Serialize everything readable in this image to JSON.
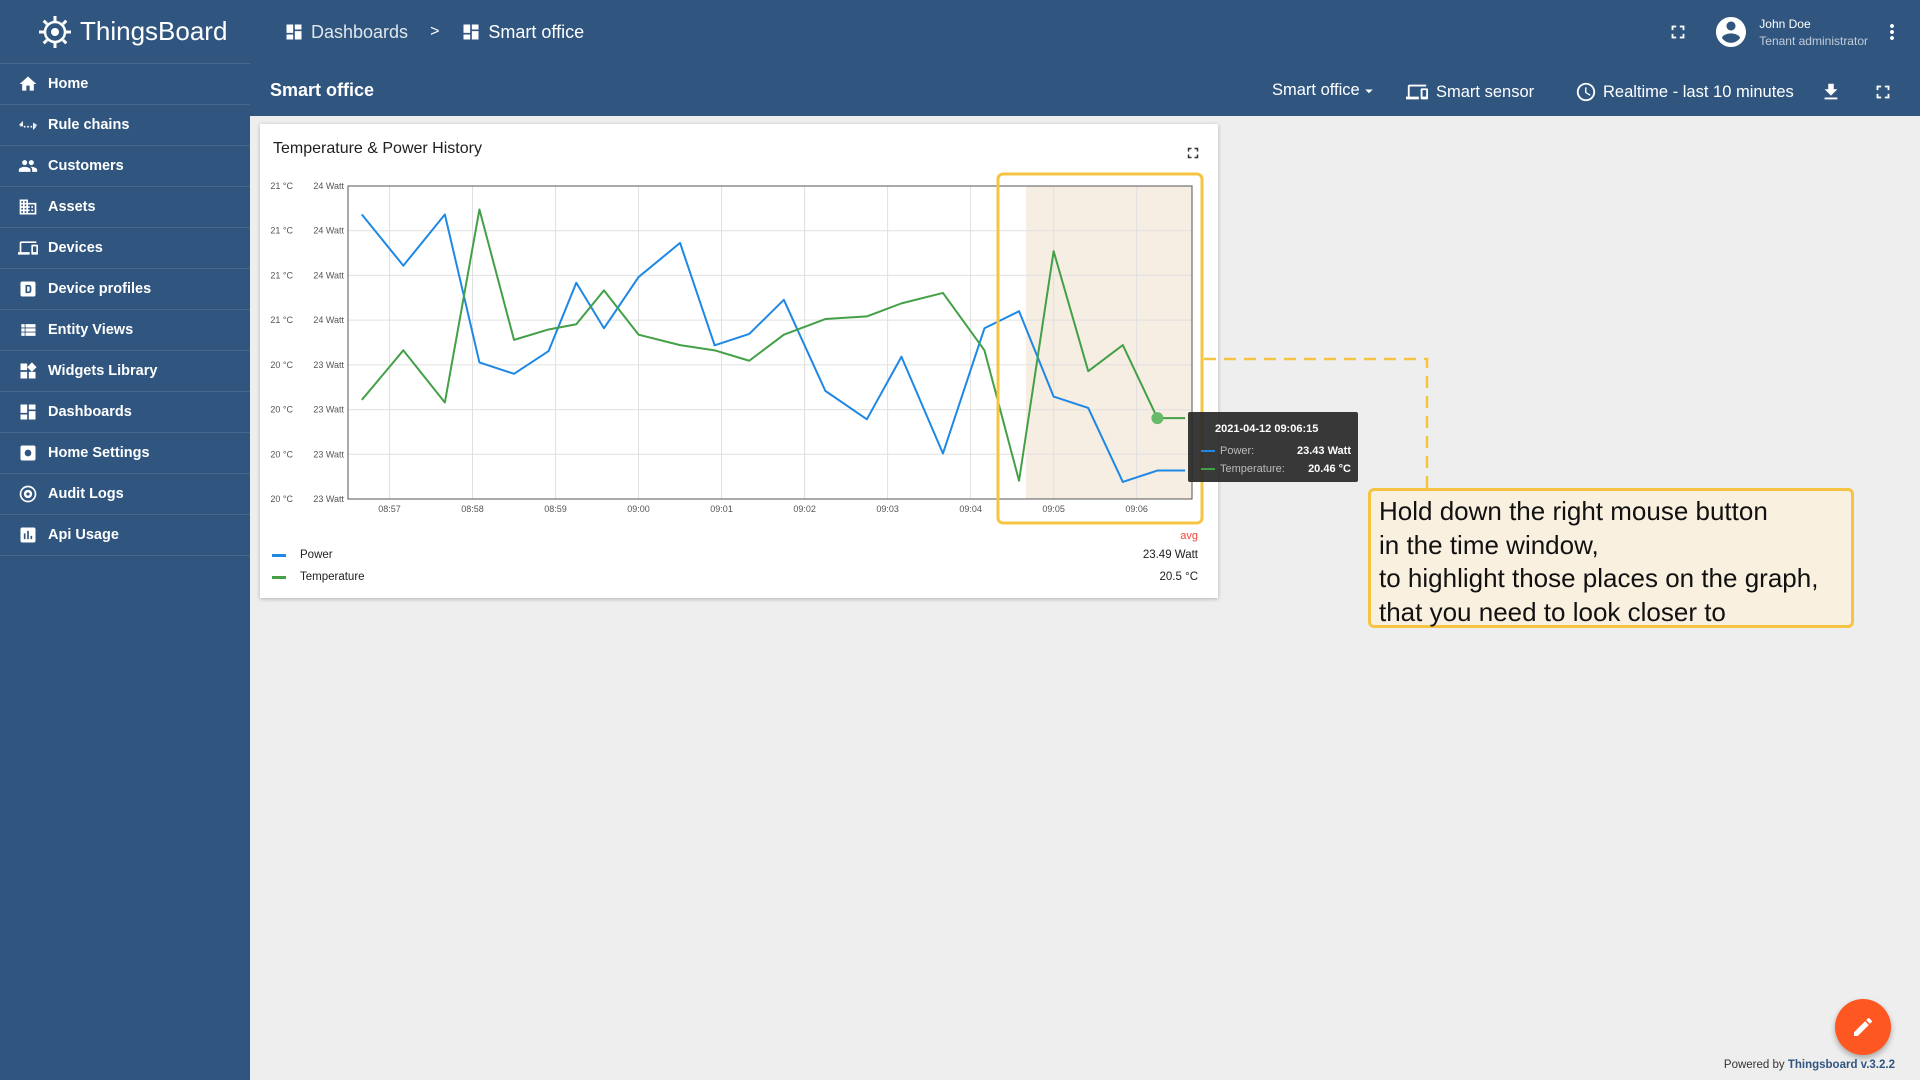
{
  "app": {
    "name": "ThingsBoard"
  },
  "sidebar": {
    "items": [
      {
        "label": "Home",
        "icon": "home-icon"
      },
      {
        "label": "Rule chains",
        "icon": "rule-chains-icon"
      },
      {
        "label": "Customers",
        "icon": "customers-icon"
      },
      {
        "label": "Assets",
        "icon": "assets-icon"
      },
      {
        "label": "Devices",
        "icon": "devices-icon"
      },
      {
        "label": "Device profiles",
        "icon": "device-profiles-icon"
      },
      {
        "label": "Entity Views",
        "icon": "entity-views-icon"
      },
      {
        "label": "Widgets Library",
        "icon": "widgets-icon"
      },
      {
        "label": "Dashboards",
        "icon": "dashboards-icon"
      },
      {
        "label": "Home Settings",
        "icon": "settings-icon"
      },
      {
        "label": "Audit Logs",
        "icon": "audit-logs-icon"
      },
      {
        "label": "Api Usage",
        "icon": "api-usage-icon"
      }
    ]
  },
  "breadcrumb": {
    "root": "Dashboards",
    "separator": ">",
    "current": "Smart office"
  },
  "user": {
    "name": "John Doe",
    "role": "Tenant administrator"
  },
  "toolbar": {
    "dashboard_title": "Smart office",
    "state_select": "Smart office",
    "entity": "Smart sensor",
    "timewindow": "Realtime - last 10 minutes"
  },
  "widget": {
    "title": "Temperature & Power History",
    "avg_header": "avg",
    "legend": [
      {
        "name": "Power",
        "color": "#1e88e5",
        "avg": "23.49 Watt"
      },
      {
        "name": "Temperature",
        "color": "#43a047",
        "avg": "20.5 °C"
      }
    ]
  },
  "chart_data": {
    "type": "line",
    "x": [
      "08:56:40",
      "08:57:10",
      "08:57:40",
      "08:58:05",
      "08:58:30",
      "08:58:55",
      "08:59:15",
      "08:59:35",
      "09:00:00",
      "09:00:30",
      "09:00:55",
      "09:01:20",
      "09:01:45",
      "09:02:15",
      "09:02:45",
      "09:03:10",
      "09:03:40",
      "09:04:10",
      "09:04:35",
      "09:05:00",
      "09:05:25",
      "09:05:50",
      "09:06:15",
      "09:06:35"
    ],
    "series": [
      {
        "name": "Power",
        "values": [
          23.88,
          23.79,
          23.88,
          23.62,
          23.6,
          23.64,
          23.76,
          23.68,
          23.77,
          23.83,
          23.65,
          23.67,
          23.73,
          23.57,
          23.52,
          23.63,
          23.46,
          23.68,
          23.71,
          23.56,
          23.54,
          23.41,
          23.43,
          23.43
        ]
      },
      {
        "name": "Temperature",
        "values": [
          20.53,
          20.72,
          20.52,
          21.26,
          20.76,
          20.8,
          20.82,
          20.95,
          20.78,
          20.74,
          20.72,
          20.68,
          20.78,
          20.84,
          20.85,
          20.9,
          20.94,
          20.72,
          20.22,
          21.1,
          20.64,
          20.74,
          20.46,
          20.46
        ]
      }
    ],
    "x_ticks": [
      "08:57",
      "08:58",
      "08:59",
      "09:00",
      "09:01",
      "09:02",
      "09:03",
      "09:04",
      "09:05",
      "09:06"
    ],
    "y_left_ticks": [
      "21 °C",
      "21 °C",
      "21 °C",
      "21 °C",
      "20 °C",
      "20 °C",
      "20 °C",
      "20 °C"
    ],
    "y_right_ticks": [
      "24 Watt",
      "24 Watt",
      "24 Watt",
      "24 Watt",
      "23 Watt",
      "23 Watt",
      "23 Watt",
      "23 Watt"
    ],
    "selection": {
      "from": "09:04:40",
      "to": "09:06:40"
    },
    "grid": true
  },
  "tooltip": {
    "time": "2021-04-12 09:06:15",
    "rows": [
      {
        "label": "Power:",
        "value": "23.43 Watt",
        "color": "#1e88e5"
      },
      {
        "label": "Temperature:",
        "value": "20.46 °C",
        "color": "#43a047"
      }
    ]
  },
  "callout": {
    "lines": [
      "Hold down the right mouse button",
      "in the time window,",
      "to highlight those places on the graph,",
      "that you need to look closer to"
    ]
  },
  "footer": {
    "prefix": "Powered by",
    "link": "Thingsboard v.3.2.2"
  }
}
